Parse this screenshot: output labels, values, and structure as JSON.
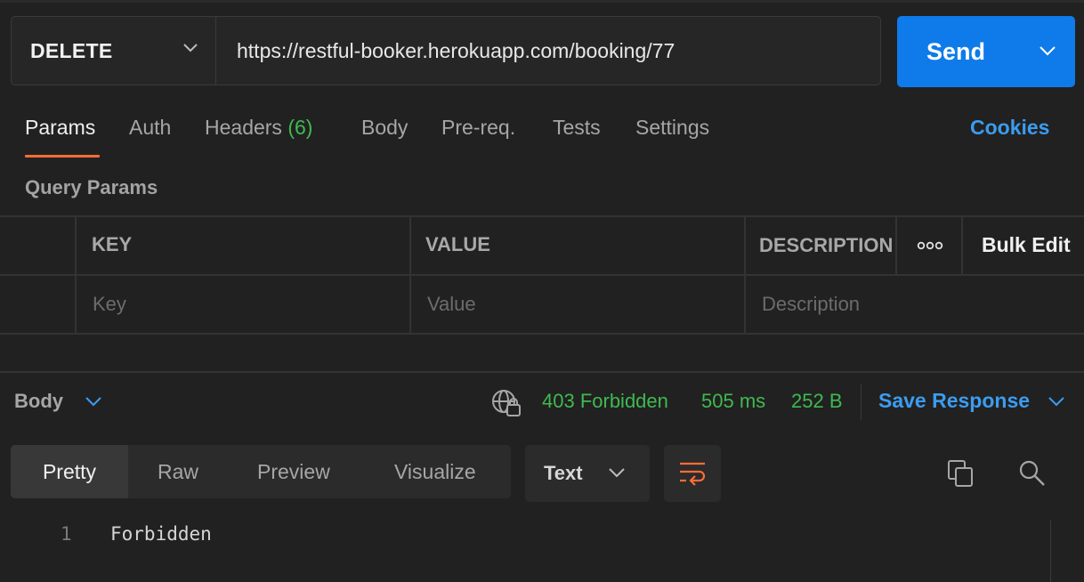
{
  "request": {
    "method": "DELETE",
    "url": "https://restful-booker.herokuapp.com/booking/77",
    "send_label": "Send"
  },
  "tabs": [
    {
      "label": "Params",
      "active": true
    },
    {
      "label": "Auth"
    },
    {
      "label": "Headers",
      "count": "(6)"
    },
    {
      "label": "Body"
    },
    {
      "label": "Pre-req."
    },
    {
      "label": "Tests"
    },
    {
      "label": "Settings"
    }
  ],
  "cookies_label": "Cookies",
  "query_params": {
    "title": "Query Params",
    "columns": [
      "KEY",
      "VALUE",
      "DESCRIPTION"
    ],
    "bulk_edit_label": "Bulk Edit",
    "placeholders": {
      "key": "Key",
      "value": "Value",
      "description": "Description"
    }
  },
  "response": {
    "body_label": "Body",
    "status": "403 Forbidden",
    "time": "505 ms",
    "size": "252 B",
    "save_label": "Save Response",
    "view_tabs": [
      "Pretty",
      "Raw",
      "Preview",
      "Visualize"
    ],
    "active_view": "Pretty",
    "format": "Text",
    "lines": [
      {
        "number": "1",
        "text": "Forbidden"
      }
    ]
  },
  "colors": {
    "accent_blue": "#0f7bea",
    "link_blue": "#3b9cf0",
    "status_green": "#3fb950",
    "tab_underline": "#ff6c37"
  }
}
